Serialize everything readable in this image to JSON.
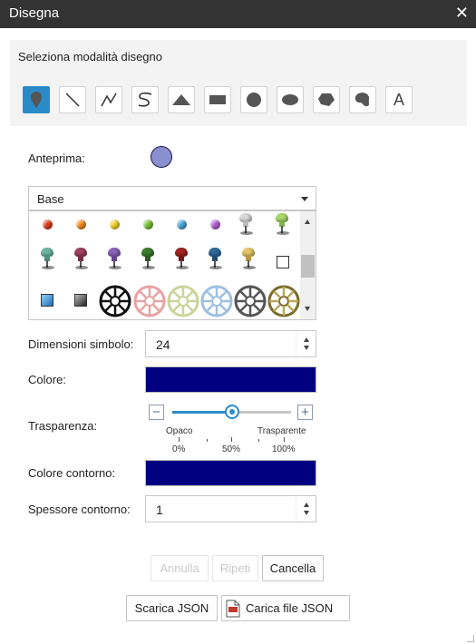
{
  "window": {
    "title": "Disegna",
    "close_icon": "close-icon"
  },
  "draw_modes": {
    "label": "Seleziona modalità disegno",
    "tools": [
      {
        "icon": "point-marker-icon",
        "active": true
      },
      {
        "icon": "line-icon",
        "active": false
      },
      {
        "icon": "polyline-icon",
        "active": false
      },
      {
        "icon": "freehand-line-icon",
        "active": false
      },
      {
        "icon": "triangle-icon",
        "active": false
      },
      {
        "icon": "rectangle-icon",
        "active": false
      },
      {
        "icon": "circle-icon",
        "active": false
      },
      {
        "icon": "ellipse-icon",
        "active": false
      },
      {
        "icon": "polygon-icon",
        "active": false
      },
      {
        "icon": "freehand-polygon-icon",
        "active": false
      },
      {
        "icon": "text-icon",
        "text": "A",
        "active": false
      }
    ]
  },
  "preview": {
    "label": "Anteprima:",
    "color": "#8a8fd0"
  },
  "symbol_set": {
    "selected": "Base"
  },
  "symbol_size": {
    "label": "Dimensioni simbolo:",
    "value": "24"
  },
  "color": {
    "label": "Colore:",
    "value": "#000080"
  },
  "transparency": {
    "label": "Trasparenza:",
    "left_label": "Opaco",
    "right_label": "Trasparente",
    "ticks": [
      "0%",
      "50%",
      "100%"
    ],
    "value_percent": 50
  },
  "outline_color": {
    "label": "Colore contorno:",
    "value": "#000080"
  },
  "outline_width": {
    "label": "Spessore contorno:",
    "value": "1"
  },
  "buttons": {
    "undo": "Annulla",
    "redo": "Ripeti",
    "clear": "Cancella",
    "download_json": "Scarica JSON",
    "upload_json": "Carica file JSON"
  }
}
